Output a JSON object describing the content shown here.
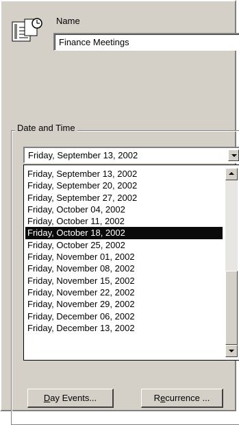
{
  "task": {
    "name_label": "Name",
    "name_value": "Finance Meetings",
    "icon": "task-notepad-icon"
  },
  "date_time": {
    "group_label": "Date and Time",
    "selected_date": "Friday, September 13, 2002",
    "dropdown_items": [
      "Friday, September 13, 2002",
      "Friday, September 20, 2002",
      "Friday, September 27, 2002",
      "Friday, October 04, 2002",
      "Friday, October 11, 2002",
      "Friday, October 18, 2002",
      "Friday, October 25, 2002",
      "Friday, November 01, 2002",
      "Friday, November 08, 2002",
      "Friday, November 15, 2002",
      "Friday, November 22, 2002",
      "Friday, November 29, 2002",
      "Friday, December 06, 2002",
      "Friday, December 13, 2002"
    ],
    "highlighted_item": "Friday, October 18, 2002"
  },
  "buttons": {
    "day_events_accel": "D",
    "day_events_rest": "ay Events...",
    "recurrence_pre": "R",
    "recurrence_accel": "e",
    "recurrence_rest": "currence ..."
  },
  "colors": {
    "window_bg": "#d4d0c8",
    "highlight": "#0a0a0a"
  }
}
